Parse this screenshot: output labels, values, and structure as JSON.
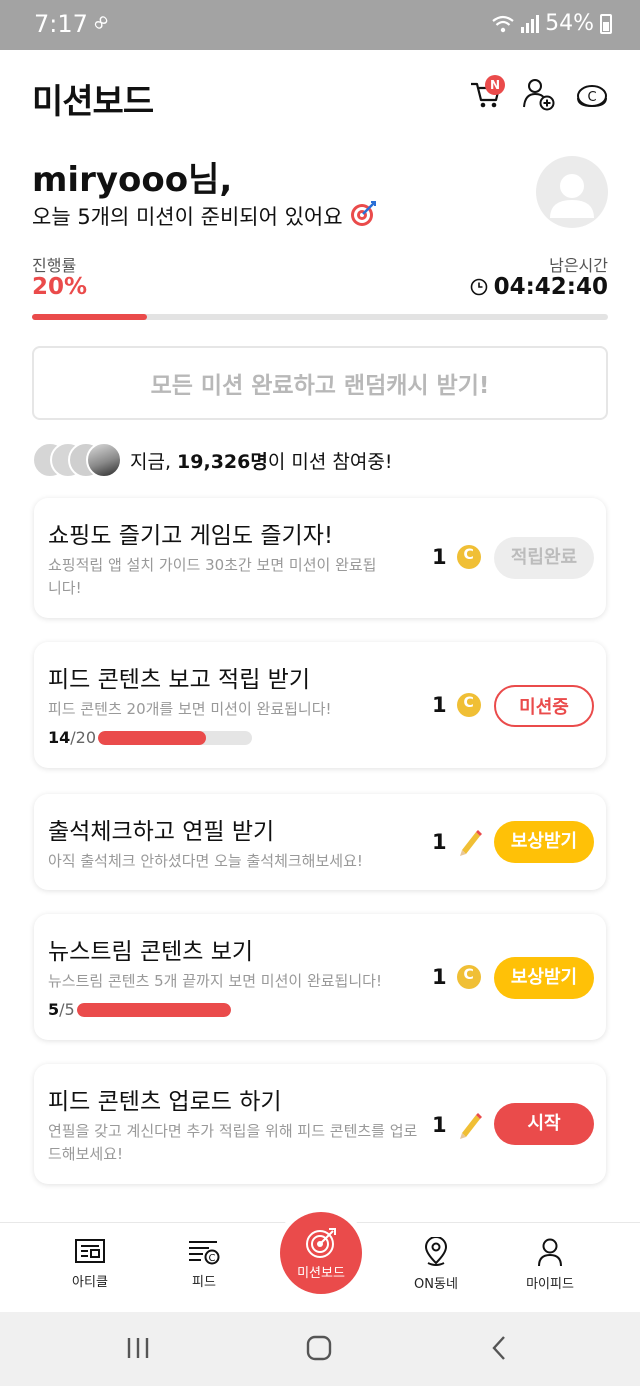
{
  "status_bar": {
    "time": "7:17",
    "battery": "54%"
  },
  "header": {
    "title": "미션보드",
    "cart_badge": "N"
  },
  "greeting": {
    "name": "miryooo님,",
    "subtitle": "오늘 5개의 미션이 준비되어 있어요"
  },
  "progress": {
    "label": "진행률",
    "value": "20%",
    "fraction": 0.2,
    "remaining_label": "남은시간",
    "remaining_time": "04:42:40"
  },
  "complete_all_button": "모든 미션 완료하고 랜덤캐시 받기!",
  "participants": {
    "prefix": "지금, ",
    "count": "19,326명",
    "suffix": "이 미션 참여중!"
  },
  "missions": [
    {
      "title": "쇼핑도 즐기고 게임도 즐기자!",
      "desc": "쇼핑적립 앱 설치 가이드 30초간 보면 미션이 완료됩니다!",
      "reward": "1",
      "reward_icon": "coin-icon",
      "action": "적립완료",
      "status": "done"
    },
    {
      "title": "피드 콘텐츠 보고 적립 받기",
      "desc": "피드 콘텐츠 20개를 보면 미션이 완료됩니다!",
      "reward": "1",
      "reward_icon": "coin-icon",
      "action": "미션중",
      "status": "in-progress",
      "progress_done": "14",
      "progress_total": "/20",
      "progress_fraction": 0.7
    },
    {
      "title": "출석체크하고 연필 받기",
      "desc": "아직 출석체크 안하셨다면 오늘 출석체크해보세요!",
      "reward": "1",
      "reward_icon": "pencil-icon",
      "action": "보상받기",
      "status": "claim"
    },
    {
      "title": "뉴스트림 콘텐츠 보기",
      "desc": "뉴스트림 콘텐츠 5개 끝까지 보면 미션이 완료됩니다!",
      "reward": "1",
      "reward_icon": "coin-icon",
      "action": "보상받기",
      "status": "claim",
      "progress_done": "5",
      "progress_total": "/5",
      "progress_fraction": 1.0
    },
    {
      "title": "피드 콘텐츠 업로드 하기",
      "desc": "연필을 갖고 계신다면 추가 적립을 위해 피드 콘텐츠를 업로드해보세요!",
      "reward": "1",
      "reward_icon": "pencil-icon",
      "action": "시작",
      "status": "start"
    }
  ],
  "bottom_nav": [
    {
      "label": "아티클",
      "icon": "article-icon"
    },
    {
      "label": "피드",
      "icon": "feed-icon"
    },
    {
      "label": "미션보드",
      "icon": "target-icon"
    },
    {
      "label": "ON동네",
      "icon": "location-pin-icon"
    },
    {
      "label": "마이피드",
      "icon": "person-icon"
    }
  ],
  "colors": {
    "accent": "#ea4b4b",
    "claim": "#ffc107",
    "coin": "#f0bf35"
  }
}
